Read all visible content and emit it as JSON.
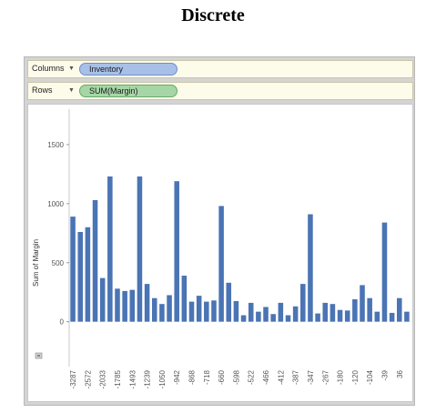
{
  "title": "Discrete",
  "shelves": {
    "columns_label": "Columns",
    "columns_pill": "Inventory",
    "rows_label": "Rows",
    "rows_pill": "SUM(Margin)"
  },
  "colors": {
    "bar": "#4a74b4",
    "columns_pill": "#a8c0e8",
    "rows_pill": "#a6d6a6"
  },
  "chart_data": {
    "type": "bar",
    "ylabel": "Sum of Margin",
    "ylim": [
      -380,
      1800
    ],
    "yticks": [
      0,
      500,
      1000,
      1500
    ],
    "grid": false,
    "values": [
      890,
      760,
      800,
      1030,
      370,
      1230,
      280,
      260,
      270,
      1230,
      320,
      200,
      150,
      225,
      1190,
      390,
      170,
      220,
      170,
      180,
      980,
      330,
      175,
      55,
      160,
      85,
      125,
      65,
      160,
      55,
      130,
      320,
      910,
      70,
      160,
      150,
      100,
      95,
      190,
      310,
      200,
      85,
      840,
      75,
      200,
      85
    ],
    "labels": [
      "-3287",
      "",
      "-2572",
      "",
      "-2033",
      "",
      "-1785",
      "",
      "-1493",
      "",
      "-1239",
      "",
      "-1050",
      "",
      "-942",
      "",
      "-868",
      "",
      "-718",
      "",
      "-660",
      "",
      "-598",
      "",
      "-522",
      "",
      "-466",
      "",
      "-412",
      "",
      "-387",
      "",
      "-347",
      "",
      "-267",
      "",
      "-180",
      "",
      "-120",
      "",
      "-104",
      "",
      "-39",
      "",
      "36",
      ""
    ]
  }
}
